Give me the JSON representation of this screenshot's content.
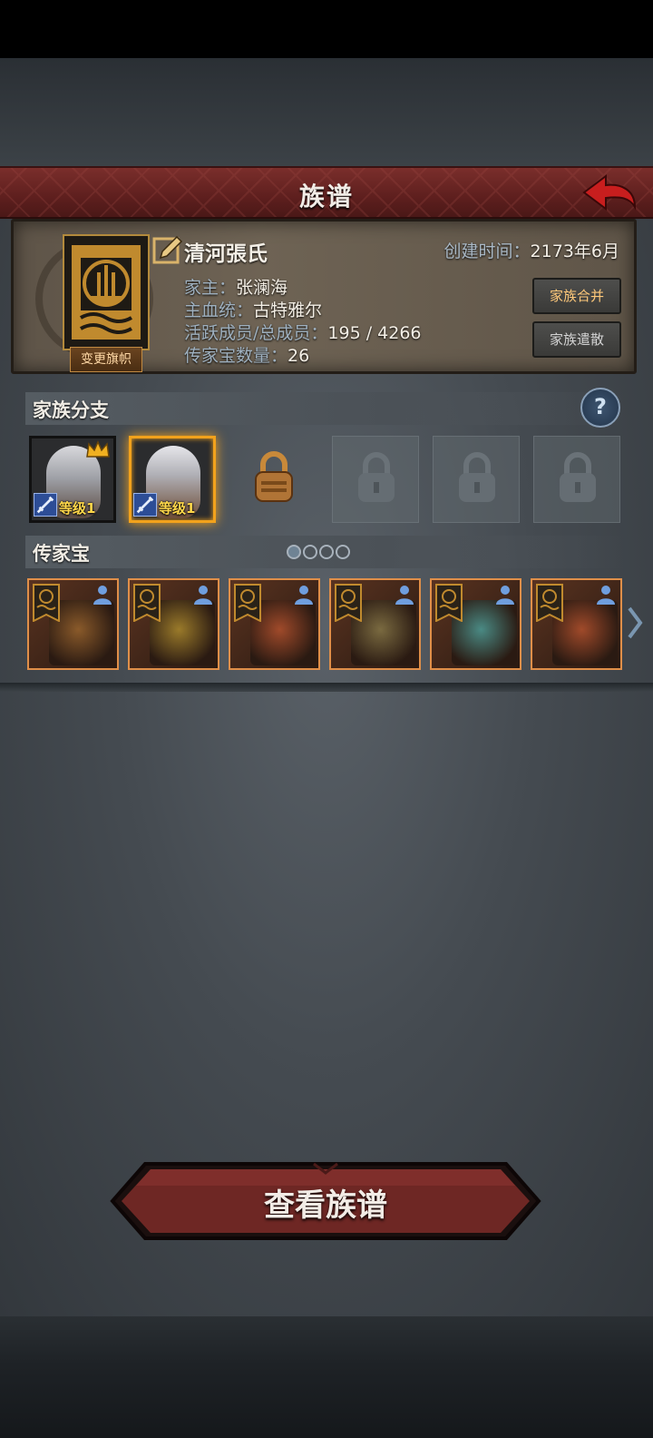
{
  "header": {
    "title": "族谱",
    "back_icon": "back-arrow-icon"
  },
  "clan": {
    "name": "清河張氏",
    "created_key": "创建时间：",
    "created_val": "2173年6月",
    "head_key": "家主：",
    "head_val": "张澜海",
    "bloodline_key": "主血统：",
    "bloodline_val": "古特雅尔",
    "members_key": "活跃成员/总成员：",
    "members_val": "195 / 4266",
    "heirlooms_key": "传家宝数量：",
    "heirlooms_val": "26",
    "change_banner_label": "变更旗帜",
    "merge_label": "家族合并",
    "disband_label": "家族遣散"
  },
  "branches": {
    "label": "家族分支",
    "help_symbol": "?",
    "heroes": [
      {
        "level": "等级1",
        "leader": true,
        "selected": false
      },
      {
        "level": "等级1",
        "leader": false,
        "selected": true
      }
    ],
    "locked_slots": 4
  },
  "heirlooms": {
    "label": "传家宝",
    "page_count": 4,
    "current_page": 1,
    "items": [
      {
        "kind": "staff",
        "color": "#8a5a2a"
      },
      {
        "kind": "shield",
        "color": "#9a7a2a"
      },
      {
        "kind": "armor",
        "color": "#a04a2a"
      },
      {
        "kind": "sword",
        "color": "#7a6a40"
      },
      {
        "kind": "jade-shield",
        "color": "#4a8a84"
      },
      {
        "kind": "armor",
        "color": "#a04a2a"
      }
    ]
  },
  "footer": {
    "view_label": "查看族谱"
  },
  "colors": {
    "accent": "#f2a21c",
    "title_bar": "#6a2624",
    "item_border": "#e08f49"
  }
}
